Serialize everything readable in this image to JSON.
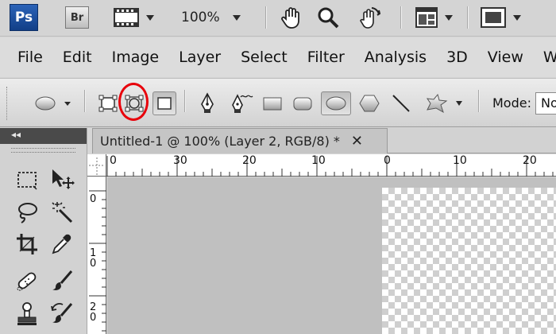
{
  "appbar": {
    "ps_logo": "Ps",
    "bridge_logo": "Br",
    "zoom_level": "100%",
    "icons": [
      "filmstrip-icon",
      "hand-icon",
      "zoom-icon",
      "rotate-view-icon",
      "arrange-documents-icon",
      "screen-mode-icon"
    ]
  },
  "menubar": {
    "items": [
      "File",
      "Edit",
      "Image",
      "Layer",
      "Select",
      "Filter",
      "Analysis",
      "3D",
      "View",
      "W"
    ]
  },
  "options": {
    "mode_label": "Mode:",
    "mode_value": "No",
    "highlight_color": "#e8000b",
    "icons": [
      "ellipse-preset-icon",
      "shape-layers-icon",
      "paths-icon",
      "fill-pixels-icon",
      "pen-icon",
      "freeform-pen-icon",
      "rectangle-icon",
      "rounded-rectangle-icon",
      "ellipse-icon",
      "polygon-icon",
      "line-icon",
      "custom-shape-icon"
    ]
  },
  "tools": {
    "collapse_label": "◂◂",
    "icons": [
      "rectangular-marquee-icon",
      "move-icon",
      "lasso-icon",
      "magic-wand-icon",
      "crop-icon",
      "eyedropper-icon",
      "spot-healing-brush-icon",
      "brush-icon",
      "clone-stamp-icon",
      "history-brush-icon"
    ]
  },
  "document": {
    "tab_title": "Untitled-1 @ 100% (Layer 2, RGB/8) *",
    "close_symbol": "✕",
    "h_ruler_labels": [
      "0",
      "30",
      "20",
      "10",
      "0",
      "10",
      "20"
    ],
    "v_ruler_labels": [
      [
        "0"
      ],
      [
        "1",
        "0"
      ],
      [
        "2",
        "0"
      ]
    ]
  }
}
